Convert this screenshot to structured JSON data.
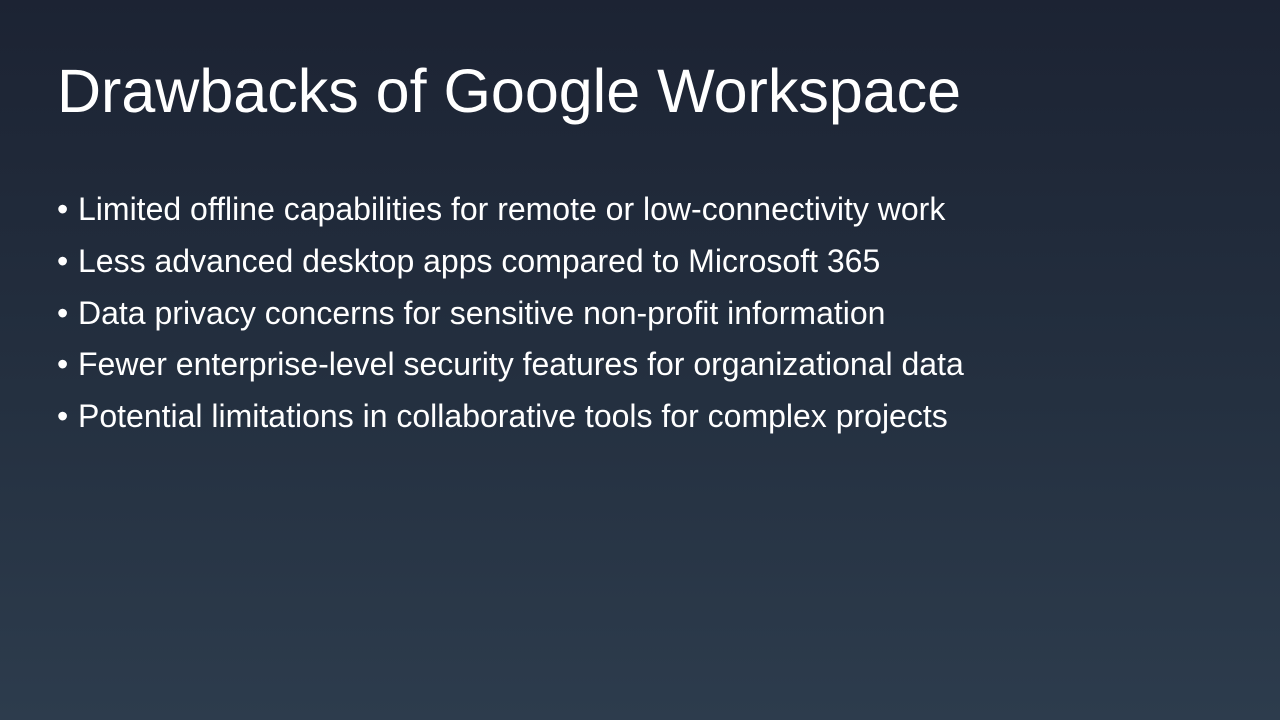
{
  "slide": {
    "title": "Drawbacks of Google Workspace",
    "bullet_glyph": "•",
    "bullets": [
      "Limited offline capabilities for remote or low-connectivity work",
      "Less advanced desktop apps compared to Microsoft 365",
      "Data privacy concerns for sensitive non-profit information",
      "Fewer enterprise-level security features for organizational data",
      "Potential limitations in collaborative tools for complex projects"
    ]
  },
  "colors": {
    "background_top": "#1c2333",
    "background_bottom": "#2d3c4d",
    "text": "#ffffff"
  }
}
